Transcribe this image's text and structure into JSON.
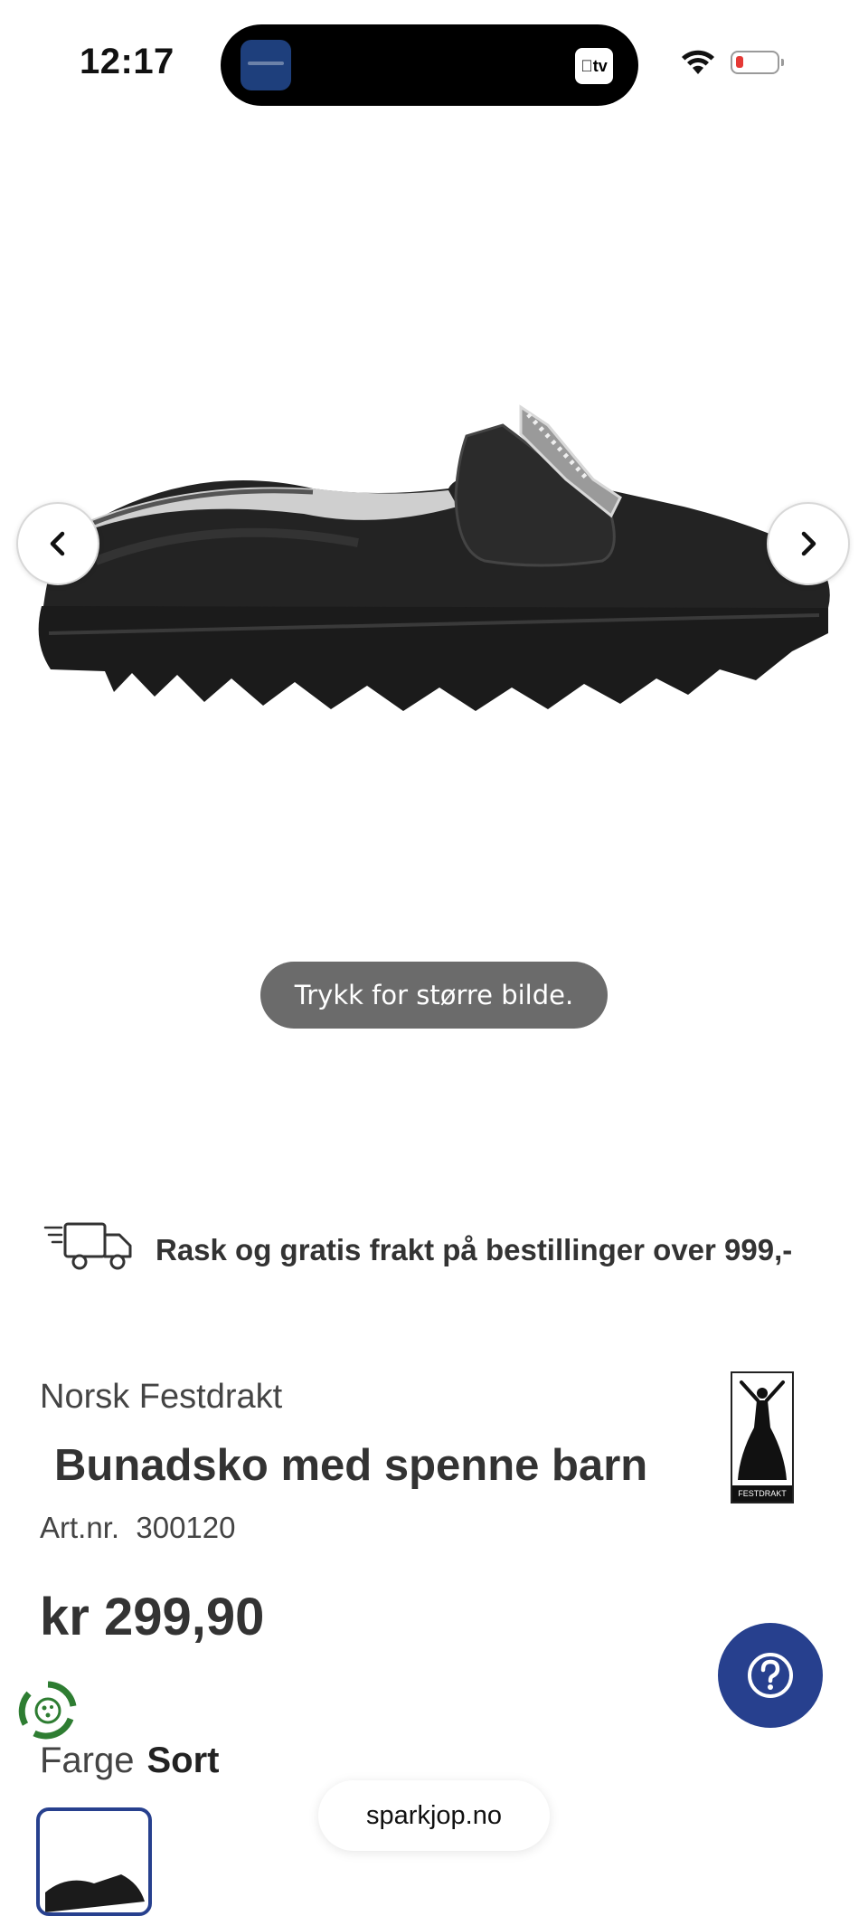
{
  "status_bar": {
    "time": "12:17",
    "island_tv_label": "tv",
    "battery_color": "#e53935"
  },
  "gallery": {
    "zoom_hint": "Trykk for større bilde.",
    "prev_icon": "chevron-left-icon",
    "next_icon": "chevron-right-icon"
  },
  "shipping": {
    "icon": "delivery-truck-icon",
    "text": "Rask og gratis frakt på bestillinger over 999,-"
  },
  "product": {
    "brand": "Norsk Festdrakt",
    "title": "Bunadsko med spenne barn",
    "art_label": "Art.nr.",
    "art_number": "300120",
    "price": "kr 299,90",
    "logo_caption": "FESTDRAKT",
    "color_label": "Farge",
    "color_value": "Sort"
  },
  "help": {
    "icon": "question-mark-icon",
    "color": "#27408e"
  },
  "browser": {
    "url": "sparkjop.no"
  }
}
